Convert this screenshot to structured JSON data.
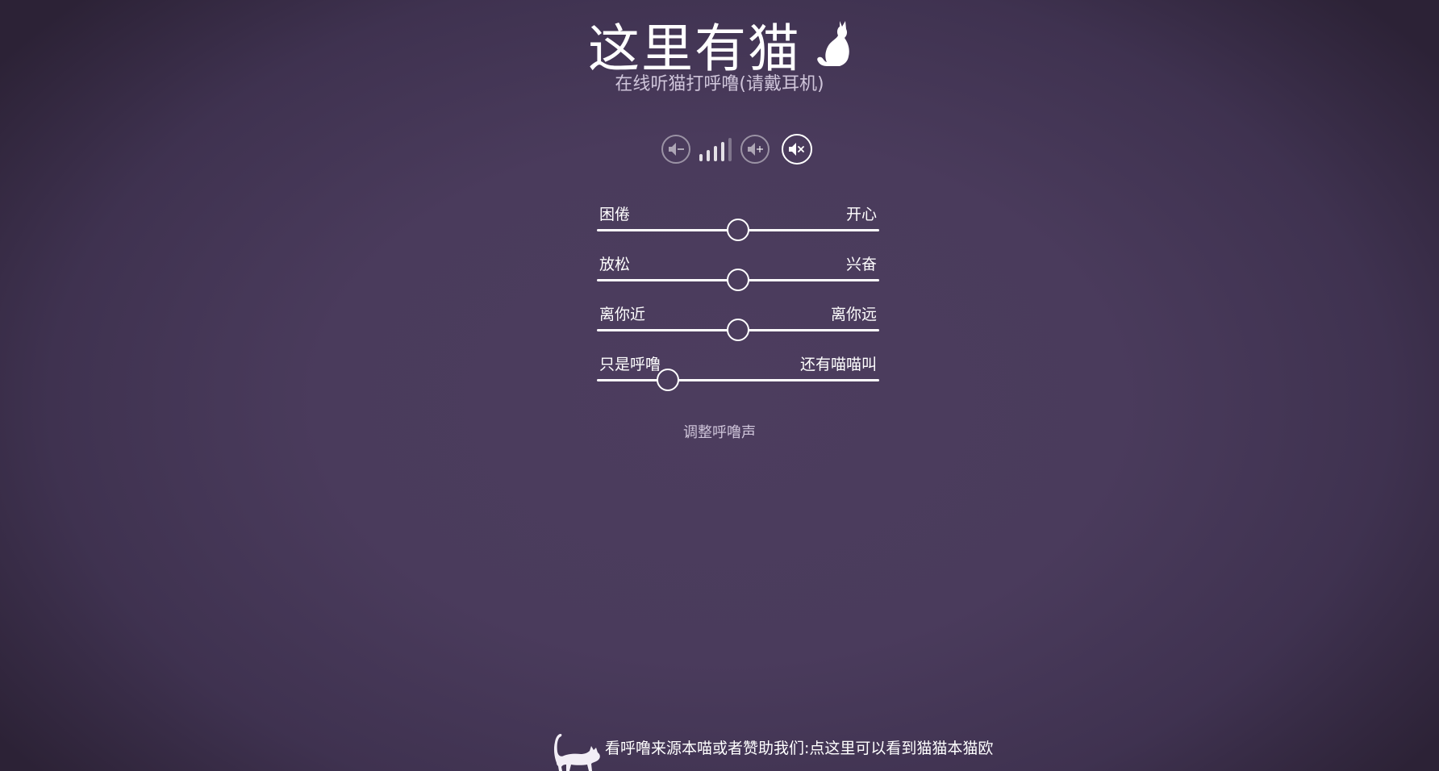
{
  "header": {
    "title": "这里有猫",
    "title_icon": "sitting-cat-icon",
    "subtitle": "在线听猫打呼噜(请戴耳机)"
  },
  "volume": {
    "down_icon": "volume-down-icon",
    "up_icon": "volume-up-icon",
    "mute_icon": "mute-icon",
    "level_bars_total": 5,
    "level_bars_active": 4,
    "muted": true
  },
  "sliders": [
    {
      "left_label": "困倦",
      "right_label": "开心",
      "value": 0.5
    },
    {
      "left_label": "放松",
      "right_label": "兴奋",
      "value": 0.5
    },
    {
      "left_label": "离你近",
      "right_label": "离你远",
      "value": 0.5
    },
    {
      "left_label": "只是呼噜",
      "right_label": "还有喵喵叫",
      "value": 0.25
    }
  ],
  "adjust_link": "调整呼噜声",
  "footer": {
    "icon": "walking-cat-icon",
    "text": "看呼噜来源本喵或者赞助我们:点这里可以看到猫猫本猫欧"
  },
  "colors": {
    "background": "#4a3b5c",
    "accent": "#ffffff",
    "muted_text": "#cfc5da"
  }
}
